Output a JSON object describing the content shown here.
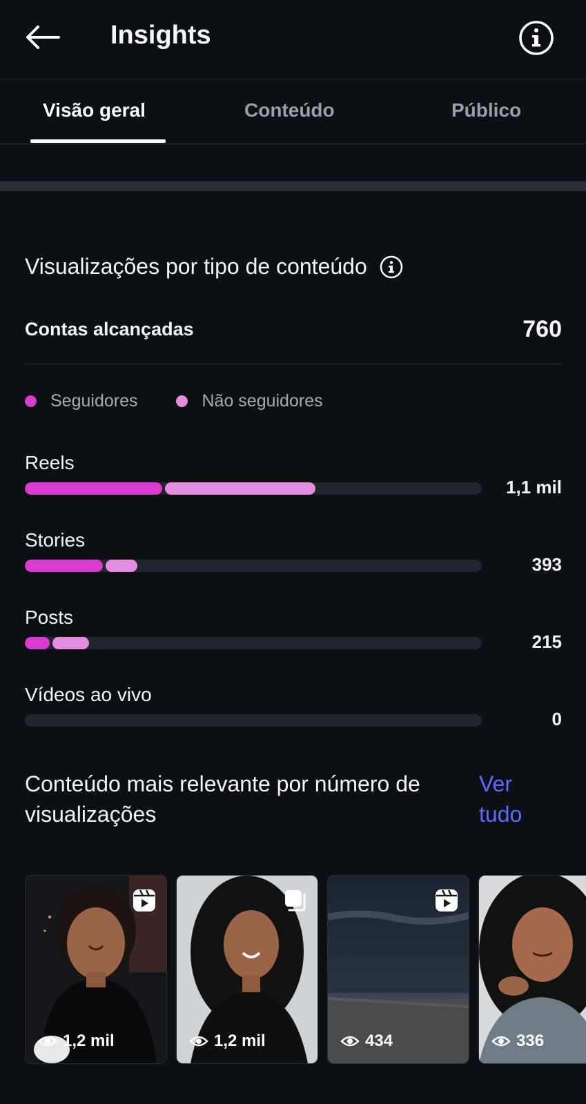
{
  "header": {
    "title": "Insights",
    "back_icon": "arrow-left-icon",
    "info_icon": "info-circle-icon"
  },
  "tabs": [
    {
      "label": "Visão geral",
      "active": true
    },
    {
      "label": "Conteúdo",
      "active": false
    },
    {
      "label": "Público",
      "active": false
    }
  ],
  "views_by_type": {
    "title": "Visualizações por tipo de conteúdo",
    "accounts_label": "Contas alcançadas",
    "accounts_value": "760",
    "legend": [
      {
        "label": "Seguidores",
        "color": "#d93ad0"
      },
      {
        "label": "Não seguidores",
        "color": "#e78de0"
      }
    ],
    "metrics": [
      {
        "label": "Reels",
        "value": "1,1 mil",
        "followers_fraction": 0.3,
        "non_followers_fraction": 0.33
      },
      {
        "label": "Stories",
        "value": "393",
        "followers_fraction": 0.17,
        "non_followers_fraction": 0.07
      },
      {
        "label": "Posts",
        "value": "215",
        "followers_fraction": 0.055,
        "non_followers_fraction": 0.08
      },
      {
        "label": "Vídeos ao vivo",
        "value": "0",
        "followers_fraction": 0,
        "non_followers_fraction": 0
      }
    ]
  },
  "top_content": {
    "title": "Conteúdo mais relevante por número de visualizações",
    "see_all": "Ver tudo",
    "items": [
      {
        "views": "1,2 mil",
        "type_icon": "reels-icon"
      },
      {
        "views": "1,2 mil",
        "type_icon": "carousel-icon"
      },
      {
        "views": "434",
        "type_icon": "reels-icon"
      },
      {
        "views": "336",
        "type_icon": "reels-icon"
      }
    ]
  },
  "colors": {
    "background": "#0c0f14",
    "followers": "#d93ad0",
    "non_followers": "#e78de0",
    "link": "#5b6cff"
  }
}
